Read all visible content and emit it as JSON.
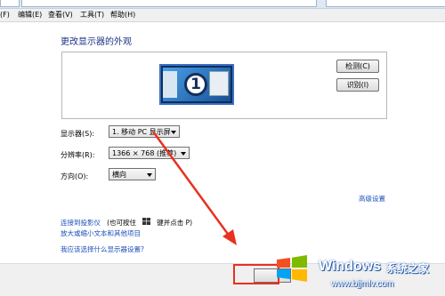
{
  "menubar": {
    "items": [
      "(F)",
      "编辑(E)",
      "查看(V)",
      "工具(T)",
      "帮助(H)"
    ]
  },
  "page": {
    "title": "更改显示器的外观"
  },
  "preview": {
    "monitor_number": "1",
    "detect_button": "检测(C)",
    "identify_button": "识别(I)"
  },
  "settings": {
    "display_label": "显示器(S):",
    "display_value": "1. 移动 PC 显示屏",
    "resolution_label": "分辨率(R):",
    "resolution_value": "1366 × 768 (推荐)",
    "orientation_label": "方向(O):",
    "orientation_value": "横向",
    "advanced_link": "高级设置"
  },
  "links": {
    "projector_link": "连接到投影仪",
    "projector_hint_prefix": "(也可按住",
    "projector_hint_suffix": "键并点击 P)",
    "text_size_link": "放大或缩小文本和其他项目",
    "which_settings_link": "我应该选择什么显示器设置?"
  },
  "watermark": {
    "brand": "Windows",
    "brand_suffix": "系统之家",
    "url": "www.bjjmlv.com"
  },
  "colors": {
    "title_blue": "#1e3287",
    "link_blue": "#1a4fb8",
    "annotation_red": "#e8311f"
  }
}
